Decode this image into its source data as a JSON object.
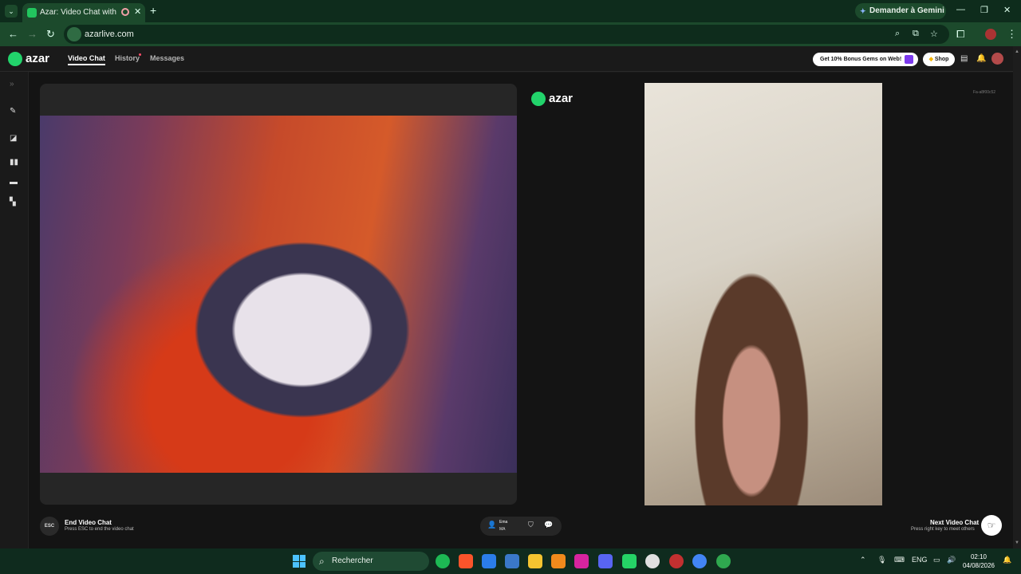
{
  "browser": {
    "tab_title": "Azar: Video Chat with New",
    "gemini_label": "Demander à Gemini",
    "url": "azarlive.com"
  },
  "nav": {
    "logo_text": "azar",
    "video_chat": "Video Chat",
    "history": "History",
    "messages": "Messages",
    "promo": "Get 10% Bonus Gems on Web!",
    "shop": "Shop"
  },
  "stage": {
    "watermark_logo": "azar",
    "tiny_id": "Fa-a8f00c52"
  },
  "controls": {
    "esc_label": "ESC",
    "end_title": "End Video Chat",
    "end_sub": "Press ESC to end the video chat",
    "peer_name": "Ema",
    "peer_country": "MA",
    "next_title": "Next Video Chat",
    "next_sub": "Press right key to meet others"
  },
  "taskbar": {
    "search_placeholder": "Rechercher",
    "lang": "ENG",
    "time": "02:10",
    "date": "04/08/2026"
  },
  "colors": {
    "brand_green": "#22d36b",
    "chrome_green": "#1c4a2c",
    "taskbar": "#0f2b1e"
  }
}
